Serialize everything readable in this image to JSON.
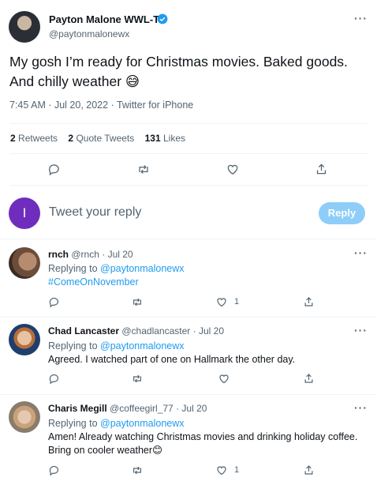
{
  "tweet": {
    "author_name": "Payton Malone WWL-TV",
    "author_handle": "@paytonmalonewx",
    "text": "My gosh I’m ready for Christmas movies. Baked goods. And chilly weather",
    "emoji": "😅",
    "meta": "7:45 AM · Jul 20, 2022 · Twitter for iPhone",
    "stats": {
      "retweets_count": "2",
      "retweets_label": "Retweets",
      "quotes_count": "2",
      "quotes_label": "Quote Tweets",
      "likes_count": "131",
      "likes_label": "Likes"
    }
  },
  "composer": {
    "avatar_letter": "I",
    "placeholder": "Tweet your reply",
    "button_label": "Reply"
  },
  "replies": [
    {
      "name": "rnch",
      "handle": "@rnch",
      "sep": "·",
      "date": "Jul 20",
      "replying_prefix": "Replying to",
      "replying_handle": "@paytonmalonewx",
      "text": "#ComeOnNovember",
      "likes": "1"
    },
    {
      "name": "Chad Lancaster",
      "handle": "@chadlancaster",
      "sep": "·",
      "date": "Jul 20",
      "replying_prefix": "Replying to",
      "replying_handle": "@paytonmalonewx",
      "text": "Agreed. I watched part of one on Hallmark the other day.",
      "likes": ""
    },
    {
      "name": "Charis Megill",
      "handle": "@coffeegirl_77",
      "sep": "·",
      "date": "Jul 20",
      "replying_prefix": "Replying to",
      "replying_handle": "@paytonmalonewx",
      "text_line1": "Amen! Already watching Christmas movies and drinking holiday coffee.",
      "text_line2": "Bring on cooler weather😊",
      "likes": "1"
    }
  ],
  "colors": {
    "accent": "#1d9bf0",
    "reply_button": "#8ecdf8",
    "composer_avatar": "#6f2dbd",
    "verified": "#1d9bf0"
  }
}
